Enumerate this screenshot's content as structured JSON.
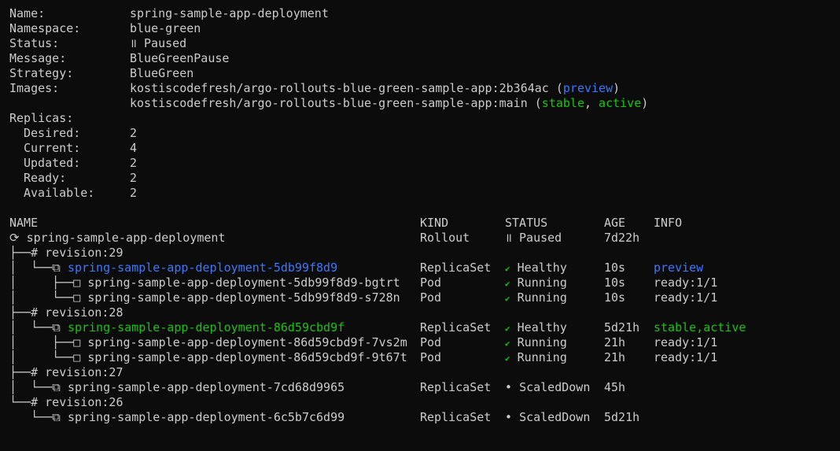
{
  "summary": {
    "name_label": "Name:",
    "name_value": "spring-sample-app-deployment",
    "namespace_label": "Namespace:",
    "namespace_value": "blue-green",
    "status_label": "Status:",
    "status_icon": "॥",
    "status_value": "Paused",
    "message_label": "Message:",
    "message_value": "BlueGreenPause",
    "strategy_label": "Strategy:",
    "strategy_value": "BlueGreen",
    "images_label": "Images:",
    "image1": "kostiscodefresh/argo-rollouts-blue-green-sample-app:2b364ac",
    "image1_tag": "preview",
    "image2": "kostiscodefresh/argo-rollouts-blue-green-sample-app:main",
    "image2_tag1": "stable",
    "image2_tag2": "active",
    "replicas_label": "Replicas:",
    "desired_label": "Desired:",
    "desired_value": "2",
    "current_label": "Current:",
    "current_value": "4",
    "updated_label": "Updated:",
    "updated_value": "2",
    "ready_label": "Ready:",
    "ready_value": "2",
    "available_label": "Available:",
    "available_value": "2"
  },
  "table": {
    "headers": {
      "name": "NAME",
      "kind": "KIND",
      "status": "STATUS",
      "age": "AGE",
      "info": "INFO"
    },
    "rows": [
      {
        "prefix": "⟳ ",
        "name": "spring-sample-app-deployment",
        "kind": "Rollout",
        "icon": "॥",
        "status": "Paused",
        "age": "7d22h",
        "info": ""
      },
      {
        "prefix": "├──# ",
        "name": "revision:29",
        "kind": "",
        "icon": "",
        "status": "",
        "age": "",
        "info": ""
      },
      {
        "prefix": "│  └──⧉ ",
        "name": "spring-sample-app-deployment-5db99f8d9",
        "kind": "ReplicaSet",
        "icon": "✔",
        "status": "Healthy",
        "age": "10s",
        "info": "preview"
      },
      {
        "prefix": "│     ├──□ ",
        "name": "spring-sample-app-deployment-5db99f8d9-bgtrt",
        "kind": "Pod",
        "icon": "✔",
        "status": "Running",
        "age": "10s",
        "info": "ready:1/1"
      },
      {
        "prefix": "│     └──□ ",
        "name": "spring-sample-app-deployment-5db99f8d9-s728n",
        "kind": "Pod",
        "icon": "✔",
        "status": "Running",
        "age": "10s",
        "info": "ready:1/1"
      },
      {
        "prefix": "├──# ",
        "name": "revision:28",
        "kind": "",
        "icon": "",
        "status": "",
        "age": "",
        "info": ""
      },
      {
        "prefix": "│  └──⧉ ",
        "name": "spring-sample-app-deployment-86d59cbd9f",
        "kind": "ReplicaSet",
        "icon": "✔",
        "status": "Healthy",
        "age": "5d21h",
        "info": "stable,active"
      },
      {
        "prefix": "│     ├──□ ",
        "name": "spring-sample-app-deployment-86d59cbd9f-7vs2m",
        "kind": "Pod",
        "icon": "✔",
        "status": "Running",
        "age": "21h",
        "info": "ready:1/1"
      },
      {
        "prefix": "│     └──□ ",
        "name": "spring-sample-app-deployment-86d59cbd9f-9t67t",
        "kind": "Pod",
        "icon": "✔",
        "status": "Running",
        "age": "21h",
        "info": "ready:1/1"
      },
      {
        "prefix": "├──# ",
        "name": "revision:27",
        "kind": "",
        "icon": "",
        "status": "",
        "age": "",
        "info": ""
      },
      {
        "prefix": "│  └──⧉ ",
        "name": "spring-sample-app-deployment-7cd68d9965",
        "kind": "ReplicaSet",
        "icon": "•",
        "status": "ScaledDown",
        "age": "45h",
        "info": ""
      },
      {
        "prefix": "└──# ",
        "name": "revision:26",
        "kind": "",
        "icon": "",
        "status": "",
        "age": "",
        "info": ""
      },
      {
        "prefix": "   └──⧉ ",
        "name": "spring-sample-app-deployment-6c5b7c6d99",
        "kind": "ReplicaSet",
        "icon": "•",
        "status": "ScaledDown",
        "age": "5d21h",
        "info": ""
      }
    ]
  },
  "colors": {
    "background": "#0c0c0c",
    "text": "#cccccc",
    "blue": "#3b78ff",
    "green": "#16c60c"
  }
}
